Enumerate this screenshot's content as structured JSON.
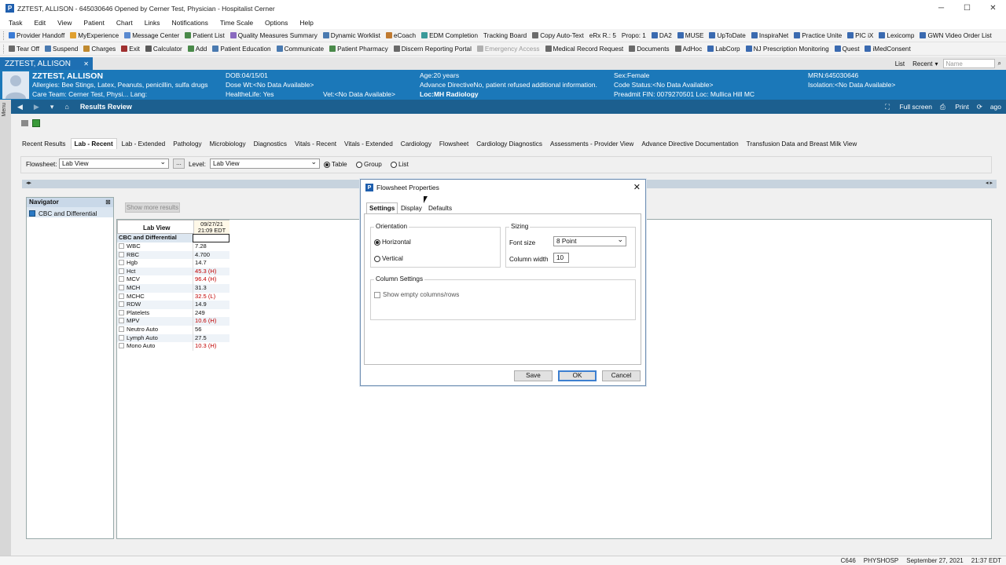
{
  "window": {
    "title": "ZZTEST, ALLISON - 645030646 Opened by Cerner Test, Physician - Hospitalist Cerner",
    "app_icon": "P",
    "min": "─",
    "max": "☐",
    "close": "✕"
  },
  "menu": [
    "Task",
    "Edit",
    "View",
    "Patient",
    "Chart",
    "Links",
    "Notifications",
    "Time Scale",
    "Options",
    "Help"
  ],
  "toolbar1": [
    {
      "label": "Provider Handoff",
      "color": "#3a7bd5"
    },
    {
      "label": "MyExperience",
      "color": "#e0a030"
    },
    {
      "label": "Message Center",
      "color": "#5a8ad0"
    },
    {
      "label": "Patient List",
      "color": "#4a8a4a"
    },
    {
      "label": "Quality Measures Summary",
      "color": "#8a6ac0"
    },
    {
      "label": "Dynamic Worklist",
      "color": "#4a7ab0"
    },
    {
      "label": "eCoach",
      "color": "#c07a30"
    },
    {
      "label": "EDM Completion",
      "color": "#3a9a9a"
    },
    {
      "label": "Tracking Board",
      "color": ""
    },
    {
      "label": "Copy Auto-Text",
      "color": "#6a6a6a"
    },
    {
      "label": "eRx R.: 5",
      "color": ""
    },
    {
      "label": "Propo: 1",
      "color": ""
    },
    {
      "label": "DA2",
      "color": "#3a6ab0"
    },
    {
      "label": "MUSE",
      "color": "#3a6ab0"
    },
    {
      "label": "UpToDate",
      "color": "#3a6ab0"
    },
    {
      "label": "InspiraNet",
      "color": "#3a6ab0"
    },
    {
      "label": "Practice Unite",
      "color": "#3a6ab0"
    },
    {
      "label": "PIC iX",
      "color": "#3a6ab0"
    },
    {
      "label": "Lexicomp",
      "color": "#3a6ab0"
    },
    {
      "label": "GWN Video Order List",
      "color": "#3a6ab0"
    }
  ],
  "toolbar2": [
    {
      "label": "Tear Off",
      "color": "#6a6a6a",
      "disabled": false
    },
    {
      "label": "Suspend",
      "color": "#4a7ab0",
      "disabled": false
    },
    {
      "label": "Charges",
      "color": "#c08a30",
      "disabled": false
    },
    {
      "label": "Exit",
      "color": "#a03030",
      "disabled": false
    },
    {
      "label": "Calculator",
      "color": "#5a5a5a",
      "disabled": false
    },
    {
      "label": "Add",
      "color": "#4a8a4a",
      "disabled": false
    },
    {
      "label": "Patient Education",
      "color": "#4a7ab0",
      "disabled": false
    },
    {
      "label": "Communicate",
      "color": "#4a7ab0",
      "disabled": false
    },
    {
      "label": "Patient Pharmacy",
      "color": "#4a8a4a",
      "disabled": false
    },
    {
      "label": "Discern Reporting Portal",
      "color": "#6a6a6a",
      "disabled": false
    },
    {
      "label": "Emergency Access",
      "color": "#b0b0b0",
      "disabled": true
    },
    {
      "label": "Medical Record Request",
      "color": "#6a6a6a",
      "disabled": false
    },
    {
      "label": "Documents",
      "color": "#6a6a6a",
      "disabled": false
    },
    {
      "label": "AdHoc",
      "color": "#6a6a6a",
      "disabled": false
    },
    {
      "label": "LabCorp",
      "color": "#3a6ab0",
      "disabled": false
    },
    {
      "label": "NJ Prescription Monitoring",
      "color": "#3a6ab0",
      "disabled": false
    },
    {
      "label": "Quest",
      "color": "#3a6ab0",
      "disabled": false
    },
    {
      "label": "iMedConsent",
      "color": "#3a6ab0",
      "disabled": false
    }
  ],
  "patient_tab": {
    "name": "ZZTEST, ALLISON",
    "close": "✕"
  },
  "right_controls": {
    "list": "List",
    "recent": "Recent",
    "name_placeholder": "Name"
  },
  "banner": {
    "name": "ZZTEST, ALLISON",
    "allergies": "Allergies: Bee Stings, Latex, Peanuts, penicillin, sulfa drugs",
    "care_team": "Care Team: Cerner Test, Physi... Lang:",
    "dob": "DOB:04/15/01",
    "dose_wt": "Dose Wt:<No Data Available>",
    "healthe": "HealtheLife: Yes",
    "vet": "Vet:<No Data Available>",
    "age": "Age:20 years",
    "advance": "Advance DirectiveNo, patient refused additional information.",
    "loc": "Loc:MH Radiology",
    "sex": "Sex:Female",
    "code": "Code Status:<No Data Available>",
    "preadmit": "Preadmit FIN: 0079270501 Loc: Mullica Hill MC",
    "mrn": "MRN:645030646",
    "isolation": "Isolation:<No Data Available>"
  },
  "nav": {
    "title": "Results Review",
    "fullscreen": "Full screen",
    "print": "Print",
    "ago": "ago"
  },
  "side_menu": "Menu",
  "tabs": [
    "Recent Results",
    "Lab - Recent",
    "Lab - Extended",
    "Pathology",
    "Microbiology",
    "Diagnostics",
    "Vitals - Recent",
    "Vitals - Extended",
    "Cardiology",
    "Flowsheet",
    "Cardiology Diagnostics",
    "Assessments - Provider View",
    "Advance Directive Documentation",
    "Transfusion Data and Breast Milk View"
  ],
  "active_tab": "Lab - Recent",
  "flowsheet_row": {
    "flowsheet_label": "Flowsheet:",
    "flowsheet_value": "Lab View",
    "dots": "...",
    "level_label": "Level:",
    "level_value": "Lab View",
    "table": "Table",
    "group": "Group",
    "list": "List"
  },
  "navigator": {
    "title": "Navigator",
    "item": "CBC and Differential"
  },
  "show_more": "Show more results",
  "grid": {
    "view_label": "Lab View",
    "date": "09/27/21",
    "time": "21:09 EDT",
    "section": "CBC and Differential",
    "rows": [
      {
        "label": "WBC",
        "value": "7.28",
        "abnormal": false
      },
      {
        "label": "RBC",
        "value": "4.700",
        "abnormal": false
      },
      {
        "label": "Hgb",
        "value": "14.7",
        "abnormal": false
      },
      {
        "label": "Hct",
        "value": "45.3 (H)",
        "abnormal": true
      },
      {
        "label": "MCV",
        "value": "96.4 (H)",
        "abnormal": true
      },
      {
        "label": "MCH",
        "value": "31.3",
        "abnormal": false
      },
      {
        "label": "MCHC",
        "value": "32.5 (L)",
        "abnormal": true
      },
      {
        "label": "RDW",
        "value": "14.9",
        "abnormal": false
      },
      {
        "label": "Platelets",
        "value": "249",
        "abnormal": false
      },
      {
        "label": "MPV",
        "value": "10.6 (H)",
        "abnormal": true
      },
      {
        "label": "Neutro Auto",
        "value": "56",
        "abnormal": false
      },
      {
        "label": "Lymph Auto",
        "value": "27.5",
        "abnormal": false
      },
      {
        "label": "Mono Auto",
        "value": "10.3 (H)",
        "abnormal": true
      }
    ]
  },
  "dialog": {
    "title": "Flowsheet Properties",
    "close": "✕",
    "tabs": [
      "Settings",
      "Display",
      "Defaults"
    ],
    "orientation_label": "Orientation",
    "horizontal": "Horizontal",
    "vertical": "Vertical",
    "sizing_label": "Sizing",
    "font_size_label": "Font size",
    "font_size_value": "8 Point",
    "column_width_label": "Column width",
    "column_width_value": "10",
    "column_settings_label": "Column Settings",
    "show_empty": "Show empty columns/rows",
    "save": "Save",
    "ok": "OK",
    "cancel": "Cancel"
  },
  "status": {
    "code": "C646",
    "user": "PHYSHOSP",
    "datetime": "September 27, 2021",
    "time": "21:37 EDT"
  }
}
